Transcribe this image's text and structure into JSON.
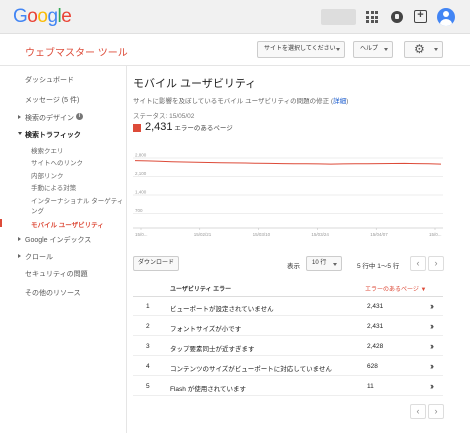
{
  "header": {
    "logo_letters": [
      "G",
      "o",
      "o",
      "g",
      "l",
      "e"
    ],
    "product": "ウェブマスター ツール",
    "site_select": "サイトを選択してください",
    "help": "ヘルプ"
  },
  "sidebar": {
    "items": [
      {
        "label": "ダッシュボード"
      },
      {
        "label": "メッセージ (5 件)"
      },
      {
        "label": "検索のデザイン"
      },
      {
        "label": "検索トラフィック"
      },
      {
        "label": "検索クエリ"
      },
      {
        "label": "サイトへのリンク"
      },
      {
        "label": "内部リンク"
      },
      {
        "label": "手動による対策"
      },
      {
        "label": "インターナショナル ターゲティ"
      },
      {
        "label": "ング"
      },
      {
        "label": "モバイル ユーザビリティ"
      },
      {
        "label": "Google インデックス"
      },
      {
        "label": "クロール"
      },
      {
        "label": "セキュリティの問題"
      },
      {
        "label": "その他のリソース"
      }
    ]
  },
  "main": {
    "title": "モバイル ユーザビリティ",
    "desc": "サイトに影響を及ぼしているモバイル ユーザビリティの問題の修正 (",
    "desc_link": "詳細",
    "desc_end": ")",
    "status": "ステータス: 15/05/02",
    "error_count": "2,431",
    "error_label": " エラーのあるページ",
    "download": "ダウンロード",
    "display": "表示",
    "rows_per_page": "10 行",
    "pager": "5 行中 1～5 行",
    "col_error": "ユーザビリティ エラー",
    "col_pages": "エラーのあるページ ▼",
    "rows": [
      {
        "n": "1",
        "error": "ビューポートが設定されていません",
        "pages": "2,431"
      },
      {
        "n": "2",
        "error": "フォントサイズが小です",
        "pages": "2,431"
      },
      {
        "n": "3",
        "error": "タップ要素同士が近すぎます",
        "pages": "2,428"
      },
      {
        "n": "4",
        "error": "コンテンツのサイズがビューポートに対応していません",
        "pages": "628"
      },
      {
        "n": "5",
        "error": "Flash が使用されています",
        "pages": "11"
      }
    ]
  },
  "chart_data": {
    "type": "line",
    "y_ticks": [
      "2,800",
      "2,100",
      "1,400",
      "700"
    ],
    "x_ticks": [
      "15/0...",
      "15/02/21",
      "15/03/10",
      "15/03/24",
      "15/04/07",
      "15/0..."
    ],
    "ylim": [
      0,
      2800
    ],
    "series": [
      {
        "color": "#dd4b39",
        "values": [
          2700,
          2690,
          2680,
          2660,
          2650,
          2640,
          2630,
          2620,
          2615,
          2610,
          2600,
          2595,
          2590,
          2585,
          2580,
          2575,
          2570,
          2575,
          2580,
          2585,
          2590,
          2592,
          2595,
          2590,
          2580,
          2570
        ]
      }
    ]
  },
  "colors": {
    "accent": "#dd4b39",
    "link": "#1155cc"
  }
}
